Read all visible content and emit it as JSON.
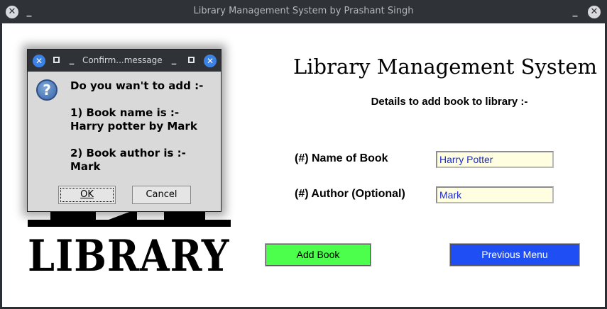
{
  "window": {
    "title": "Library Management System by Prashant Singh",
    "close_glyph": "✕"
  },
  "app": {
    "title": "Library Management System",
    "subtitle": "Details to add book to library :-",
    "logo_text": "LIBRARY",
    "fields": [
      {
        "label": "(#) Name of Book",
        "value": "Harry Potter"
      },
      {
        "label": "(#) Author (Optional)",
        "value": "Mark"
      }
    ],
    "buttons": {
      "add_book": "Add Book",
      "previous_menu": "Previous Menu"
    },
    "colors": {
      "add_book_bg": "#4cff4c",
      "previous_menu_bg": "#1f4ef5",
      "input_bg": "#fffee0",
      "input_text": "#1a2bd6"
    }
  },
  "dialog": {
    "title": "Confirm...message",
    "icon": "question-icon",
    "message": "Do you wan't to add :-\n\n1) Book name is :-\nHarry potter by Mark\n\n2) Book author is :-\nMark",
    "ok_label": "OK",
    "cancel_label": "Cancel"
  }
}
